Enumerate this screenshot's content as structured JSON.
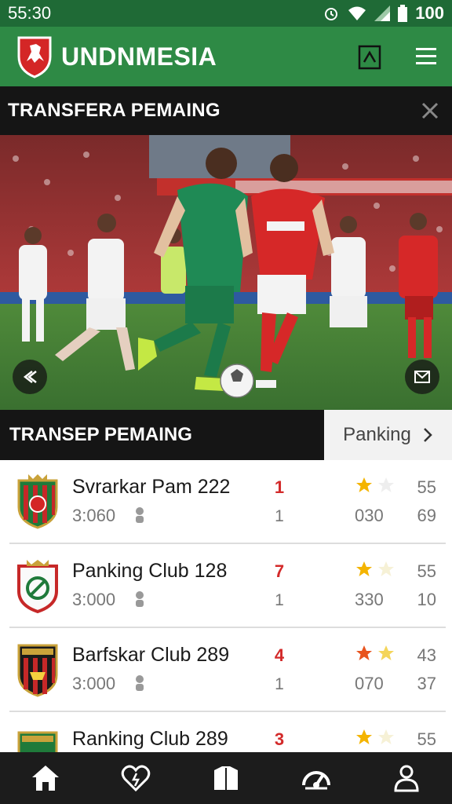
{
  "status_bar": {
    "time": "55:30",
    "battery": "100"
  },
  "app": {
    "title": "UNDNMESIA"
  },
  "banner": {
    "title": "TRANSFERA PEMAING"
  },
  "section": {
    "title": "TRANSEP PEMAING",
    "link": "Panking"
  },
  "clubs": [
    {
      "name": "Svrarkar Pam 222",
      "time": "3:060",
      "rank": "1",
      "sub": "1",
      "stars": 1,
      "points": "030",
      "value_top": "55",
      "value_bottom": "69"
    },
    {
      "name": "Panking Club 128",
      "time": "3:000",
      "rank": "7",
      "sub": "1",
      "stars": 1,
      "points": "330",
      "value_top": "55",
      "value_bottom": "10"
    },
    {
      "name": "Barfskar Club 289",
      "time": "3:000",
      "rank": "4",
      "sub": "1",
      "stars": 2,
      "points": "070",
      "value_top": "43",
      "value_bottom": "37"
    },
    {
      "name": "Ranking Club 289",
      "time": "",
      "rank": "3",
      "sub": "",
      "stars": 1,
      "points": "",
      "value_top": "55",
      "value_bottom": ""
    }
  ],
  "colors": {
    "brand_green": "#2e8a45",
    "dark_green": "#1f6a36",
    "rank_red": "#d32a2a",
    "star_gold": "#f4b400"
  },
  "bottom_nav": [
    {
      "icon": "home-icon"
    },
    {
      "icon": "heart-icon"
    },
    {
      "icon": "shirt-icon"
    },
    {
      "icon": "gauge-icon"
    },
    {
      "icon": "profile-icon"
    }
  ]
}
